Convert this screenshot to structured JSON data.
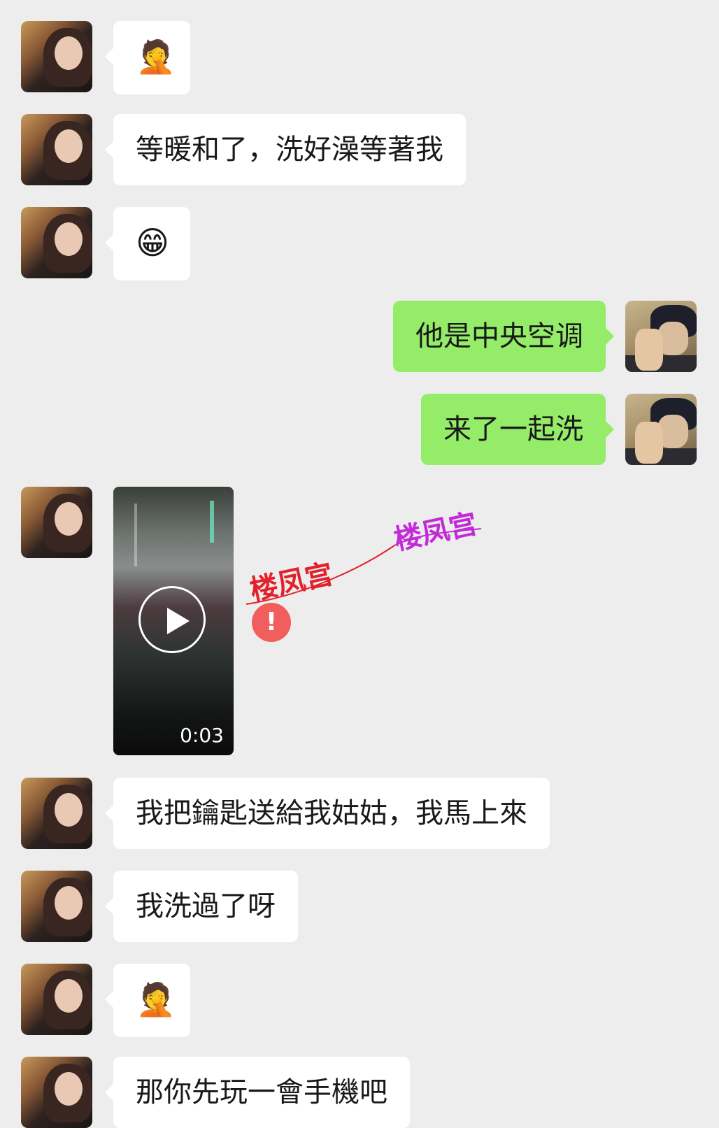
{
  "messages": [
    {
      "side": "left",
      "type": "emoji",
      "text": "🤦",
      "emoji_name": "facepalm-emoji"
    },
    {
      "side": "left",
      "type": "text",
      "text": "等暖和了，洗好澡等著我"
    },
    {
      "side": "left",
      "type": "emoji",
      "text": "😁",
      "emoji_name": "grin-emoji"
    },
    {
      "side": "right",
      "type": "text",
      "text": "他是中央空调"
    },
    {
      "side": "right",
      "type": "text",
      "text": "来了一起洗"
    },
    {
      "side": "left",
      "type": "video",
      "duration": "0:03",
      "status": "send-failed"
    },
    {
      "side": "left",
      "type": "text",
      "text": "我把鑰匙送給我姑姑，我馬上來"
    },
    {
      "side": "left",
      "type": "text",
      "text": "我洗過了呀"
    },
    {
      "side": "left",
      "type": "emoji",
      "text": "🤦",
      "emoji_name": "facepalm-emoji"
    },
    {
      "side": "left",
      "type": "text",
      "text": "那你先玩一會手機吧"
    }
  ],
  "watermark": {
    "text": "楼凤宫",
    "colors": [
      "#e4202a",
      "#c22ad8"
    ]
  },
  "error_badge": "!",
  "colors": {
    "background": "#ededed",
    "left_bubble": "#ffffff",
    "right_bubble": "#95ec69",
    "error": "#f25d5d"
  }
}
